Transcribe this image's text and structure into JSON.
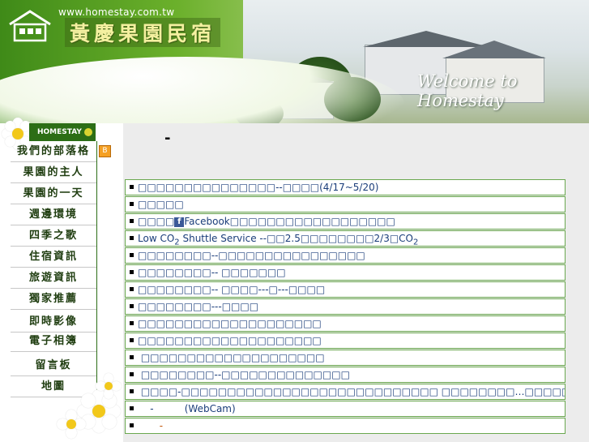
{
  "header": {
    "url": "www.homestay.com.tw",
    "site_title": "黃慶果園民宿",
    "welcome": "Welcome to Homestay"
  },
  "nav": {
    "badge": "HOMESTAY",
    "blog_icon": "B",
    "items": [
      {
        "label": "我們的部落格"
      },
      {
        "label": "果園的主人"
      },
      {
        "label": "果園的一天"
      },
      {
        "label": "週邊環境"
      },
      {
        "label": "四季之歌"
      },
      {
        "label": "住宿資訊"
      },
      {
        "label": "旅遊資訊"
      },
      {
        "label": "獨家推薦"
      },
      {
        "label": "即時影像"
      },
      {
        "label": "電子相簿"
      },
      {
        "label": "留言板"
      },
      {
        "label": "地圖"
      }
    ]
  },
  "main": {
    "heading": "-",
    "news": [
      {
        "text": "□□□□□□□□□□□□□□□--□□□□(4/17~5/20)"
      },
      {
        "text": "□□□□□"
      },
      {
        "prefix": "□□□□",
        "icon": "f",
        "text": "Facebook□□□□□□□□□□□□□□□□□□"
      },
      {
        "text": "Low CO",
        "sub": "2",
        "text2": " Shuttle Service --□□2.5□□□□□□□□2/3□CO",
        "sub2": "2"
      },
      {
        "text": "□□□□□□□□--□□□□□□□□□□□□□□□□"
      },
      {
        "text": "□□□□□□□□-- □□□□□□□"
      },
      {
        "text": "□□□□□□□□-- □□□□---□---□□□□"
      },
      {
        "text": "□□□□□□□□---□□□□"
      },
      {
        "text": "□□□□□□□□□□□□□□□□□□□□"
      },
      {
        "text": "□□□□□□□□□□□□□□□□□□□□"
      },
      {
        "text": " □□□□□□□□□□□□□□□□□□□□"
      },
      {
        "text": " □□□□□□□□--□□□□□□□□□□□□□□"
      },
      {
        "text": " □□□□-□□□□□□□□□□□□□□□□□□□□□□□□□□□□ □□□□□□□□…□□□□□□□"
      },
      {
        "text": "    -          (WebCam)"
      },
      {
        "text": "       -"
      }
    ]
  },
  "colors": {
    "accent_green": "#2c6e16",
    "row_border": "#6aa84f",
    "link_blue": "#1a3d7a"
  }
}
